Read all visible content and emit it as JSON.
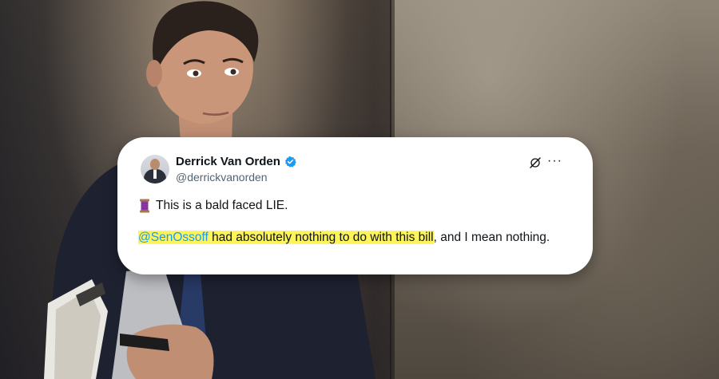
{
  "tweet": {
    "author_name": "Derrick Van Orden",
    "author_handle": "@derrickvanorden",
    "line1": "This is a bald faced LIE.",
    "mention": "@SenOssoff",
    "highlighted_text": " had absolutely nothing to do with this bill",
    "rest_text": ", and I mean nothing.",
    "icons": {
      "verified": "verified-badge-icon",
      "grok": "grok-icon",
      "more": "more-options-icon",
      "emoji": "thread-spool-icon"
    }
  },
  "colors": {
    "highlight": "#fcf45a",
    "mention": "#1d9bf0",
    "verified": "#1d9bf0",
    "handle": "#536471"
  }
}
